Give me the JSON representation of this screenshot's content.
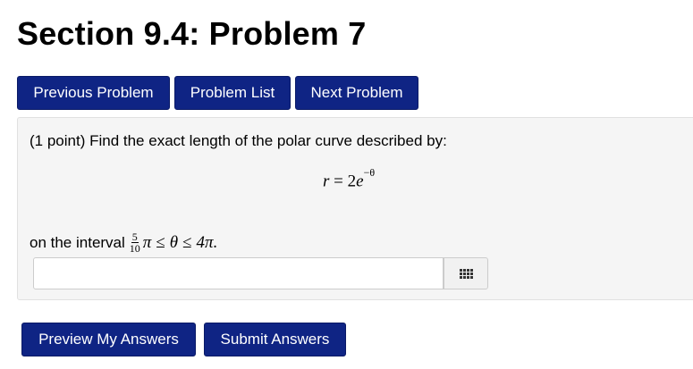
{
  "page": {
    "title": "Section 9.4: Problem 7"
  },
  "nav": {
    "previous_label": "Previous Problem",
    "list_label": "Problem List",
    "next_label": "Next Problem"
  },
  "problem": {
    "prompt": "(1 point) Find the exact length of the polar curve described by:",
    "equation": {
      "lhs": "r",
      "eq": "=",
      "coefficient": "2",
      "base": "e",
      "exponent": "−θ"
    },
    "interval_text": "on the interval",
    "interval": {
      "frac_num": "5",
      "frac_den": "10",
      "pi": "π",
      "le1": "≤",
      "theta": "θ",
      "le2": "≤",
      "upper": "4π."
    },
    "answer": {
      "value": "",
      "palette_icon": "grid-icon"
    }
  },
  "actions": {
    "preview_label": "Preview My Answers",
    "submit_label": "Submit Answers"
  },
  "colors": {
    "button_bg": "#0f2484",
    "panel_bg": "#f5f5f5"
  }
}
